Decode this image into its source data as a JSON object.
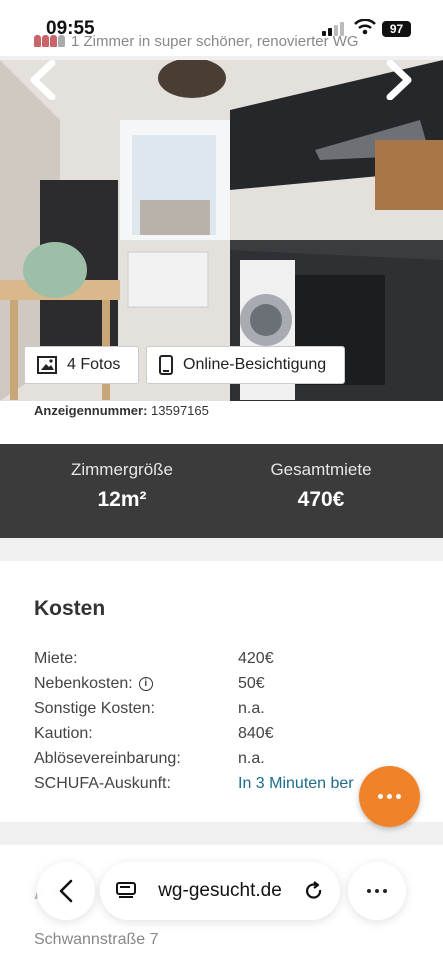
{
  "status_bar": {
    "time": "09:55",
    "battery": "97"
  },
  "page_header": {
    "title": "1 Zimmer in super schöner, renovierter WG"
  },
  "gallery": {
    "photos_button": "4 Fotos",
    "visit_button": "Online-Besichtigung"
  },
  "ad": {
    "number_label": "Anzeigennummer:",
    "number_value": "13597165"
  },
  "stats": {
    "room_size_label": "Zimmergröße",
    "room_size_value": "12m²",
    "total_rent_label": "Gesamtmiete",
    "total_rent_value": "470€"
  },
  "costs": {
    "title": "Kosten",
    "rows": [
      {
        "label": "Miete:",
        "value": "420€"
      },
      {
        "label": "Nebenkosten:",
        "value": "50€",
        "info_icon": true
      },
      {
        "label": "Sonstige Kosten:",
        "value": "n.a."
      },
      {
        "label": "Kaution:",
        "value": "840€"
      },
      {
        "label": "Ablösevereinbarung:",
        "value": "n.a."
      },
      {
        "label": "SCHUFA-Auskunft:",
        "value": "In 3 Minuten ber"
      }
    ]
  },
  "address": {
    "heading_partial": "A        s",
    "street": "Schwannstraße 7"
  },
  "browser": {
    "url": "wg-gesucht.de"
  },
  "colors": {
    "accent": "#f0832a",
    "dark_band": "#3b3b3b",
    "link": "#1c6c8c"
  }
}
